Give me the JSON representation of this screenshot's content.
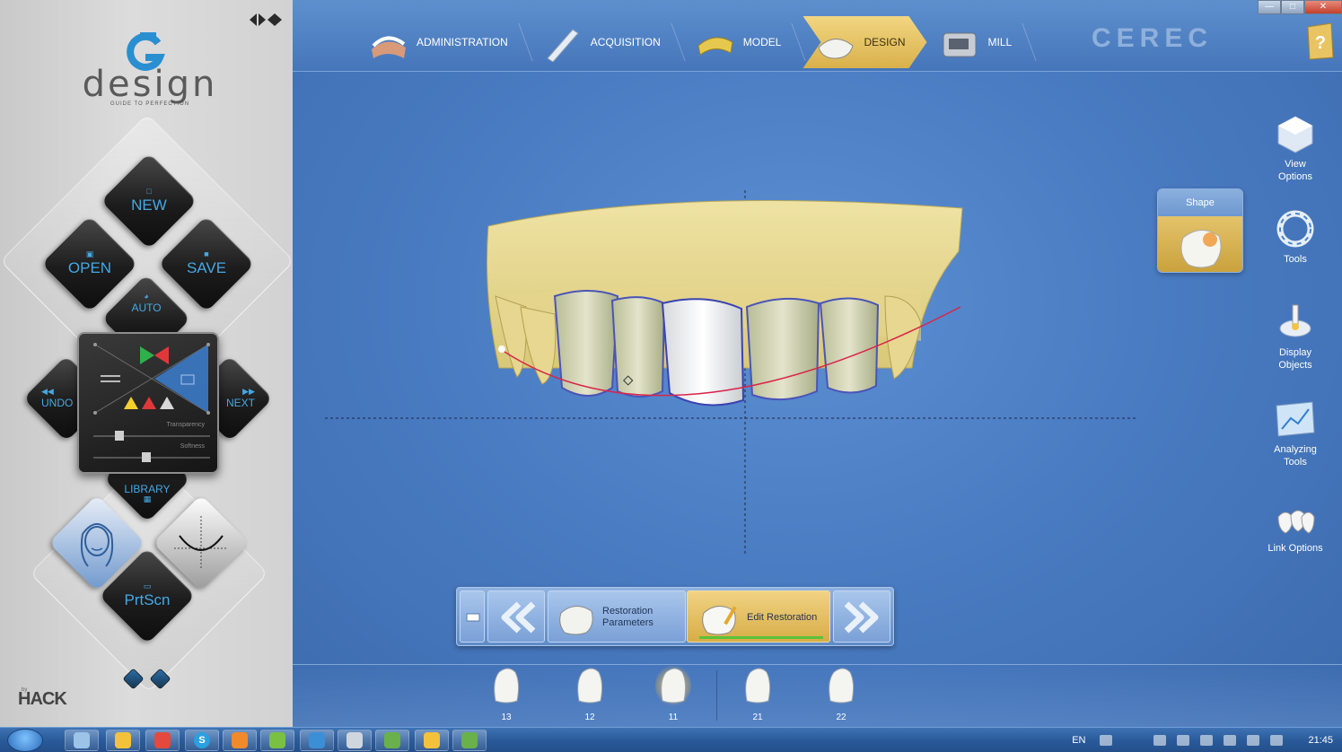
{
  "left_panel": {
    "logo_word": "design",
    "logo_tagline": "GUIDE TO PERFECTION",
    "buttons": {
      "new": "NEW",
      "open": "OPEN",
      "save": "SAVE",
      "auto": "AUTO",
      "undo": "UNDO",
      "next": "NEXT",
      "library": "LIBRARY",
      "prtscr": "PrtScn"
    },
    "sliders": {
      "top_label": "Transparency",
      "bottom_label": "Softness"
    },
    "footer_by": "by",
    "footer_logo": "HACK"
  },
  "topbar": {
    "steps": [
      {
        "label": "ADMINISTRATION",
        "icon": "teeth-model-icon"
      },
      {
        "label": "ACQUISITION",
        "icon": "scanner-icon"
      },
      {
        "label": "MODEL",
        "icon": "model-icon"
      },
      {
        "label": "DESIGN",
        "icon": "design-icon",
        "active": true
      },
      {
        "label": "MILL",
        "icon": "mill-icon"
      }
    ],
    "brand": "CEREC"
  },
  "right_toolbar": {
    "shape_card": "Shape",
    "view_options": "View Options",
    "tools": "Tools",
    "display_objects": "Display Objects",
    "analyzing_tools": "Analyzing Tools",
    "link_options": "Link Options"
  },
  "step_bar": {
    "restoration_parameters": "Restoration Parameters",
    "edit_restoration": "Edit Restoration"
  },
  "teeth": [
    {
      "number": "13",
      "selected": false
    },
    {
      "number": "12",
      "selected": false
    },
    {
      "number": "11",
      "selected": true
    },
    {
      "number": "21",
      "selected": false
    },
    {
      "number": "22",
      "selected": false
    }
  ],
  "taskbar": {
    "apps": [
      "smiley-app",
      "chrome-app",
      "skype-app",
      "media-app",
      "green-app",
      "blue-app",
      "cerec-app",
      "project-app",
      "smiley-app-2",
      "project-app-2"
    ],
    "skype_letter": "S",
    "language": "EN",
    "time": "21:45"
  },
  "colors": {
    "accent_gold": "#d9b14a",
    "viewport_blue": "#4a7cc3",
    "button_text_blue": "#46a8e4",
    "margin_line": "#d8264a"
  }
}
